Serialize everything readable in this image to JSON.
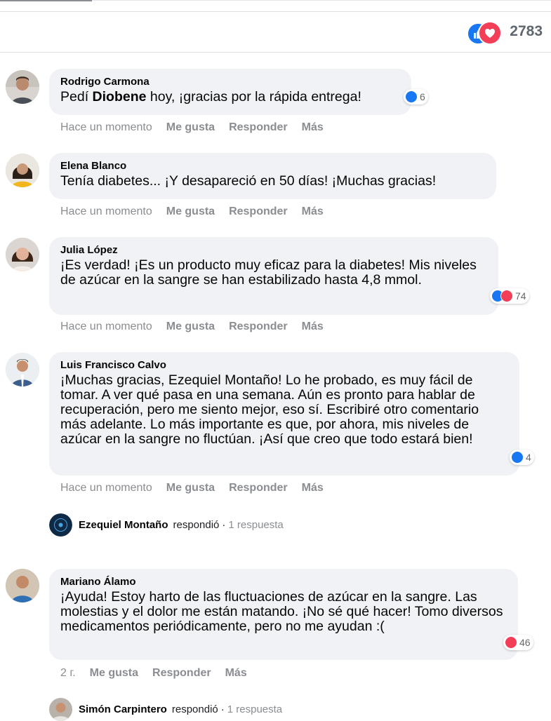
{
  "header": {
    "reaction_total": "2783",
    "reaction_icons": [
      "like-icon",
      "love-icon"
    ],
    "colors": {
      "like": "#1877f2",
      "love": "#f33e58"
    }
  },
  "comments": [
    {
      "author": "Rodrigo Carmona",
      "text_before": "Pedí ",
      "text_bold": "Diobene",
      "text_after": " hoy, ¡gracias por la rápida entrega!",
      "reaction_count": "6",
      "time": "Hace un momento",
      "like": "Me gusta",
      "reply": "Responder",
      "more": "Más"
    },
    {
      "author": "Elena Blanco",
      "text": "Tenía diabetes... ¡Y desapareció en 50 días! ¡Muchas gracias!",
      "time": "Hace un momento",
      "like": "Me gusta",
      "reply": "Responder",
      "more": "Más"
    },
    {
      "author": "Julia López",
      "text": "¡Es verdad! ¡Es un producto muy eficaz para la diabetes! Mis niveles de azúcar en la sangre se han estabilizado hasta 4,8 mmol.",
      "reaction_count": "74",
      "time": "Hace un momento",
      "like": "Me gusta",
      "reply": "Responder",
      "more": "Más"
    },
    {
      "author": "Luis Francisco Calvo",
      "text": "¡Muchas gracias, Ezequiel Montaño! Lo he probado, es muy fácil de tomar. A ver qué pasa en una semana. Aún es pronto para hablar de recuperación, pero me siento mejor, eso sí. Escribiré otro comentario más adelante. Lo más importante es que, por ahora, mis niveles de azúcar en la sangre no fluctúan. ¡Así que creo que todo estará bien!",
      "reaction_count": "4",
      "time": "Hace un momento",
      "like": "Me gusta",
      "reply": "Responder",
      "more": "Más",
      "reply_row": {
        "name": "Ezequiel Montaño",
        "verb": "respondió",
        "sep": "·",
        "count": "1 respuesta"
      }
    },
    {
      "author": "Mariano Álamo",
      "text": "¡Ayuda! Estoy harto de las fluctuaciones de azúcar en la sangre. Las molestias y el dolor me están matando. ¡No sé qué hacer! Tomo diversos medicamentos periódicamente, pero no me ayudan :(",
      "reaction_count": "46",
      "time": "2 г.",
      "like": "Me gusta",
      "reply": "Responder",
      "more": "Más",
      "reply_row": {
        "name": "Simón Carpintero",
        "verb": "respondió",
        "sep": "·",
        "count": "1 respuesta"
      }
    }
  ]
}
